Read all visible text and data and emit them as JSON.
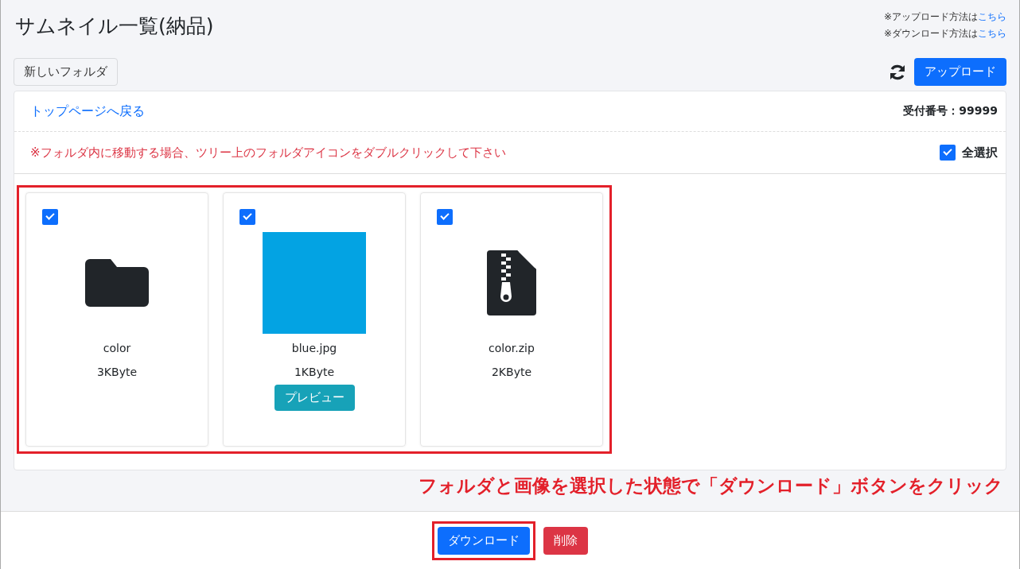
{
  "title": "サムネイル一覧(納品)",
  "help_notes": [
    {
      "text": "※アップロード方法は",
      "link": "こちら"
    },
    {
      "text": "※ダウンロード方法は",
      "link": "こちら"
    }
  ],
  "toolbar": {
    "new_folder_button": "新しいフォルダ",
    "upload_button": "アップロード"
  },
  "panel": {
    "back_link": "トップページへ戻る",
    "receipt_number": "受付番号：99999",
    "notice": "※フォルダ内に移動する場合、ツリー上のフォルダアイコンをダブルクリックして下さい",
    "select_all": {
      "label": "全選択",
      "checked": true
    },
    "files": [
      {
        "kind": "folder",
        "name": "color",
        "size": "3KByte",
        "checked": true
      },
      {
        "name": "blue.jpg",
        "size": "1KByte",
        "checked": true,
        "preview_button": "プレビュー"
      },
      {
        "kind": "zip",
        "name": "color.zip",
        "size": "2KByte",
        "checked": true
      }
    ]
  },
  "annotation": "フォルダと画像を選択した状態で「ダウンロード」ボタンをクリック",
  "footer": {
    "download_button": "ダウンロード",
    "delete_button": "削除"
  }
}
